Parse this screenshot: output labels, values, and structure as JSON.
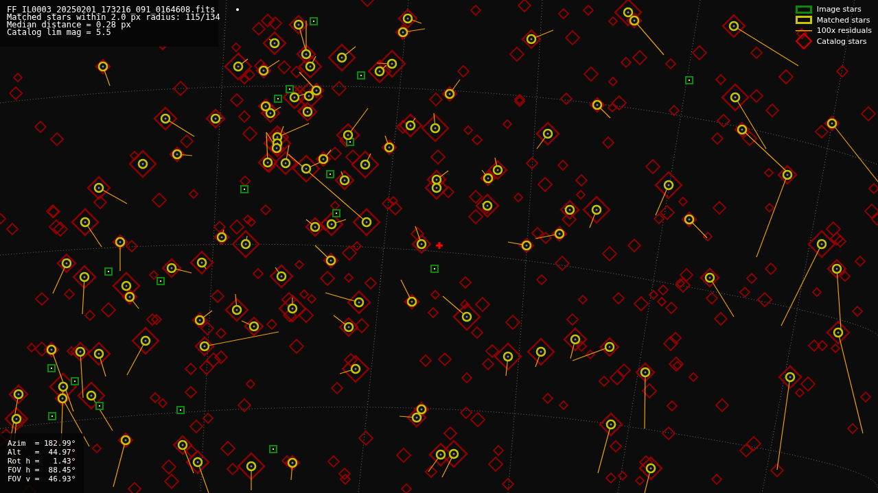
{
  "file_info": {
    "lines": [
      "FF_IL0003_20250201_173216_091_0164608.fits",
      "Matched stars within 2.0 px radius: 115/134",
      "Median distance = 0.28 px",
      "Catalog lim mag = 5.5"
    ]
  },
  "legend": {
    "items": [
      {
        "kind": "image",
        "label": "Image stars"
      },
      {
        "kind": "matched",
        "label": "Matched stars"
      },
      {
        "kind": "residual",
        "label": "100x residuals"
      },
      {
        "kind": "catalog",
        "label": "Catalog stars"
      }
    ]
  },
  "pointing": {
    "lines": [
      "Azim  = 182.99°",
      "Alt   =  44.97°",
      "Rot h =   1.43°",
      "FOV h =  88.45°",
      "FOV v =  46.93°"
    ]
  }
}
